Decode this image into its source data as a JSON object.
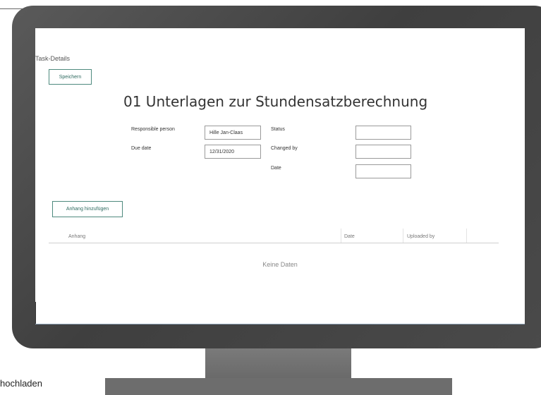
{
  "page": {
    "task_details_label": "Task-Details",
    "save_label": "Speichern",
    "title": "01 Unterlagen zur Stundensatzberechnung",
    "caption": "hochladen"
  },
  "fields": {
    "responsible_label": "Responsible person",
    "responsible_value": "Hille Jan-Claas",
    "due_label": "Due date",
    "due_value": "12/31/2020",
    "status_label": "Status",
    "status_value": "",
    "changed_by_label": "Changed by",
    "changed_by_value": "",
    "date_label": "Date",
    "date_value": ""
  },
  "attachments": {
    "add_label": "Anhang hinzufügen",
    "columns": [
      "Anhang",
      "Date",
      "Uploaded by"
    ],
    "empty_text": "Keine Daten"
  },
  "colors": {
    "accent": "#2f6b60",
    "monitor_bezel": "#4a4a4a"
  }
}
